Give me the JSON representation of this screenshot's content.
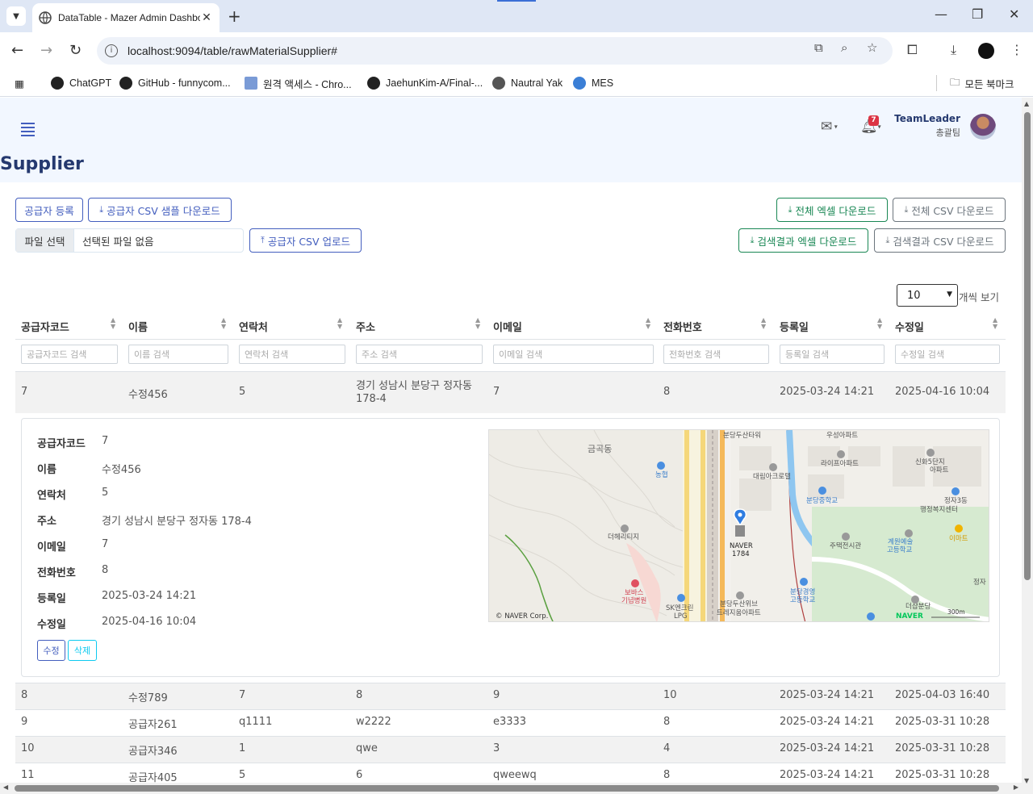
{
  "browser": {
    "tab_title": "DataTable - Mazer Admin Dashboard",
    "url": "localhost:9094/table/rawMaterialSupplier#",
    "bookmarks": [
      "ChatGPT",
      "GitHub - funnycom...",
      "원격 액세스 - Chro...",
      "JaehunKim-A/Final-...",
      "Nautral Yak",
      "MES"
    ],
    "all_bookmarks": "모든 북마크"
  },
  "header": {
    "user_name": "TeamLeader",
    "user_role": "총괄팀",
    "notification_count": "7"
  },
  "page_title": "Supplier",
  "actions": {
    "register": "공급자 등록",
    "csv_sample": "공급자 CSV 샘플 다운로드",
    "file_choose": "파일 선택",
    "file_none": "선택된 파일 없음",
    "csv_upload": "공급자 CSV 업로드",
    "excel_all": "전체 엑셀 다운로드",
    "csv_all": "전체 CSV 다운로드",
    "excel_search": "검색결과 엑셀 다운로드",
    "csv_search": "검색결과 CSV 다운로드"
  },
  "table": {
    "per_page": "10",
    "per_page_label": "개씩 보기",
    "columns": [
      "공급자코드",
      "이름",
      "연락처",
      "주소",
      "이메일",
      "전화번호",
      "등록일",
      "수정일"
    ],
    "filters": [
      "공급자코드 검색",
      "이름 검색",
      "연락처 검색",
      "주소 검색",
      "이메일 검색",
      "전화번호 검색",
      "등록일 검색",
      "수정일 검색"
    ],
    "first_row": {
      "code": "7",
      "name": "수정456",
      "contact": "5",
      "address_line1": "경기 성남시 분당구 정자동",
      "address_line2": "178-4",
      "email": "7",
      "phone": "8",
      "created": "2025-03-24 14:21",
      "modified": "2025-04-16 10:04"
    },
    "rows": [
      [
        "8",
        "수정789",
        "7",
        "8",
        "9",
        "10",
        "2025-03-24 14:21",
        "2025-04-03 16:40"
      ],
      [
        "9",
        "공급자261",
        "q1111",
        "w2222",
        "e3333",
        "8",
        "2025-03-24 14:21",
        "2025-03-31 10:28"
      ],
      [
        "10",
        "공급자346",
        "1",
        "qwe",
        "3",
        "4",
        "2025-03-24 14:21",
        "2025-03-31 10:28"
      ],
      [
        "11",
        "공급자405",
        "5",
        "6",
        "qweewq",
        "8",
        "2025-03-24 14:21",
        "2025-03-31 10:28"
      ]
    ]
  },
  "detail": {
    "labels": [
      "공급자코드",
      "이름",
      "연락처",
      "주소",
      "이메일",
      "전화번호",
      "등록일",
      "수정일"
    ],
    "values": [
      "7",
      "수정456",
      "5",
      "경기 성남시 분당구 정자동 178-4",
      "7",
      "8",
      "2025-03-24 14:21",
      "2025-04-16 10:04"
    ],
    "edit": "수정",
    "delete": "삭제"
  },
  "map": {
    "labels": [
      "금곡동",
      "분당두산타워",
      "우성아파트",
      "라이프아파트",
      "신화5단지 아파트",
      "대림아크로텔",
      "분당중학교",
      "정자3동 행정복지센터",
      "농협",
      "더헤리티지",
      "NAVER 1784",
      "주택전시관",
      "계원예술 고등학교",
      "이마트",
      "보바스 기념병원",
      "SK엔크린 LPG",
      "분당두산위브 트레지움아파트",
      "분당경영 고등학교",
      "더샵분당",
      "정자"
    ],
    "copyright": "© NAVER Corp.",
    "scale": "300m",
    "brand": "NAVER"
  }
}
